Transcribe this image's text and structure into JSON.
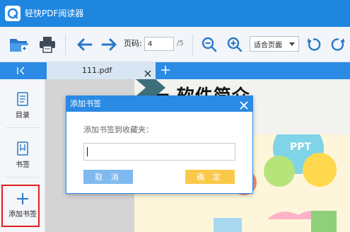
{
  "app": {
    "title": "轻快PDF阅读器"
  },
  "toolbar": {
    "page_label": "页码:",
    "current_page": "4",
    "total_pages": "/5",
    "zoom_mode": "适合页面"
  },
  "tabs": {
    "document": "111.pdf"
  },
  "sidebar": {
    "items": [
      {
        "label": "目录",
        "icon": "document-list-icon"
      },
      {
        "label": "书签",
        "icon": "bookmark-icon"
      },
      {
        "label": "添加书签",
        "icon": "plus-icon"
      }
    ]
  },
  "document": {
    "heading": "一  软件简介",
    "badge": "PPT"
  },
  "dialog": {
    "title": "添加书签",
    "prompt": "添加书签到收藏夹：",
    "input_value": "",
    "cancel_label": "取 消",
    "ok_label": "确 定"
  },
  "colors": {
    "titlebar": "#1f86e0",
    "accent": "#2b8ae3",
    "cancel_button": "#7fb9ef",
    "ok_button": "#fbc94a",
    "highlight": "#e02020"
  }
}
